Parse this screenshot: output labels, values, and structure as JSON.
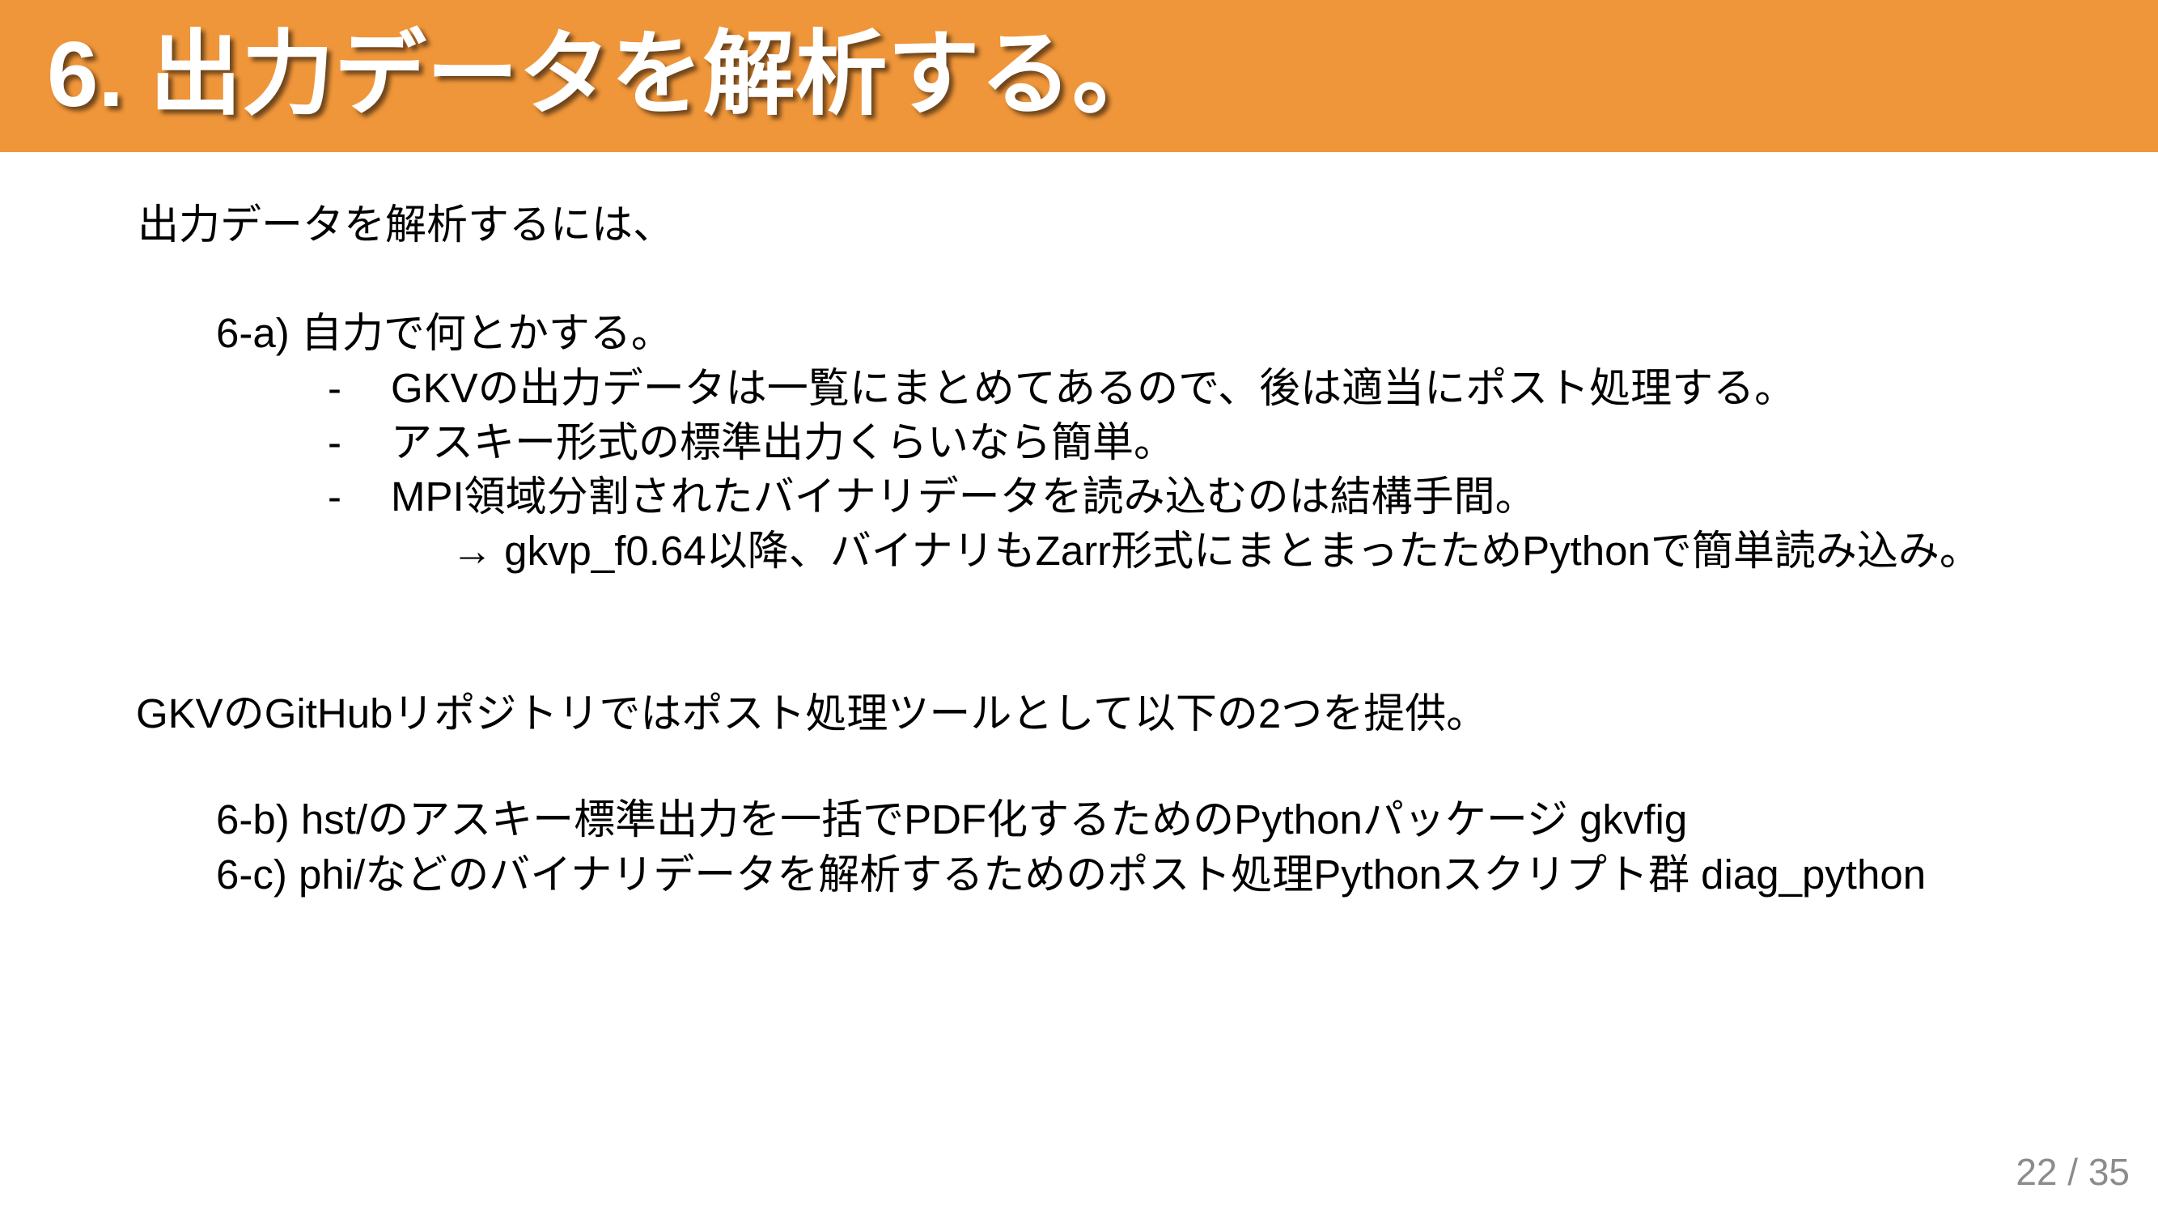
{
  "title": "6. 出力データを解析する。",
  "accent_color": "#f0963a",
  "intro": "出力データを解析するには、",
  "item_a": {
    "label": "6-a) 自力で何とかする。",
    "bullets": [
      {
        "marker": "-",
        "text": "GKVの出力データは一覧にまとめてあるので、後は適当にポスト処理する。"
      },
      {
        "marker": "-",
        "text": "アスキー形式の標準出力くらいなら簡単。"
      },
      {
        "marker": "-",
        "text": "MPI領域分割されたバイナリデータを読み込むのは結構手間。"
      }
    ],
    "arrow_note": "→ gkvp_f0.64以降、バイナリもZarr形式にまとまったためPythonで簡単読み込み。"
  },
  "github_intro": "GKVのGitHubリポジトリではポスト処理ツールとして以下の2つを提供。",
  "item_b": "6-b) hst/のアスキー標準出力を一括でPDF化するためのPythonパッケージ gkvfig",
  "item_c": "6-c) phi/などのバイナリデータを解析するためのポスト処理Pythonスクリプト群 diag_python",
  "page_number": "22 / 35"
}
